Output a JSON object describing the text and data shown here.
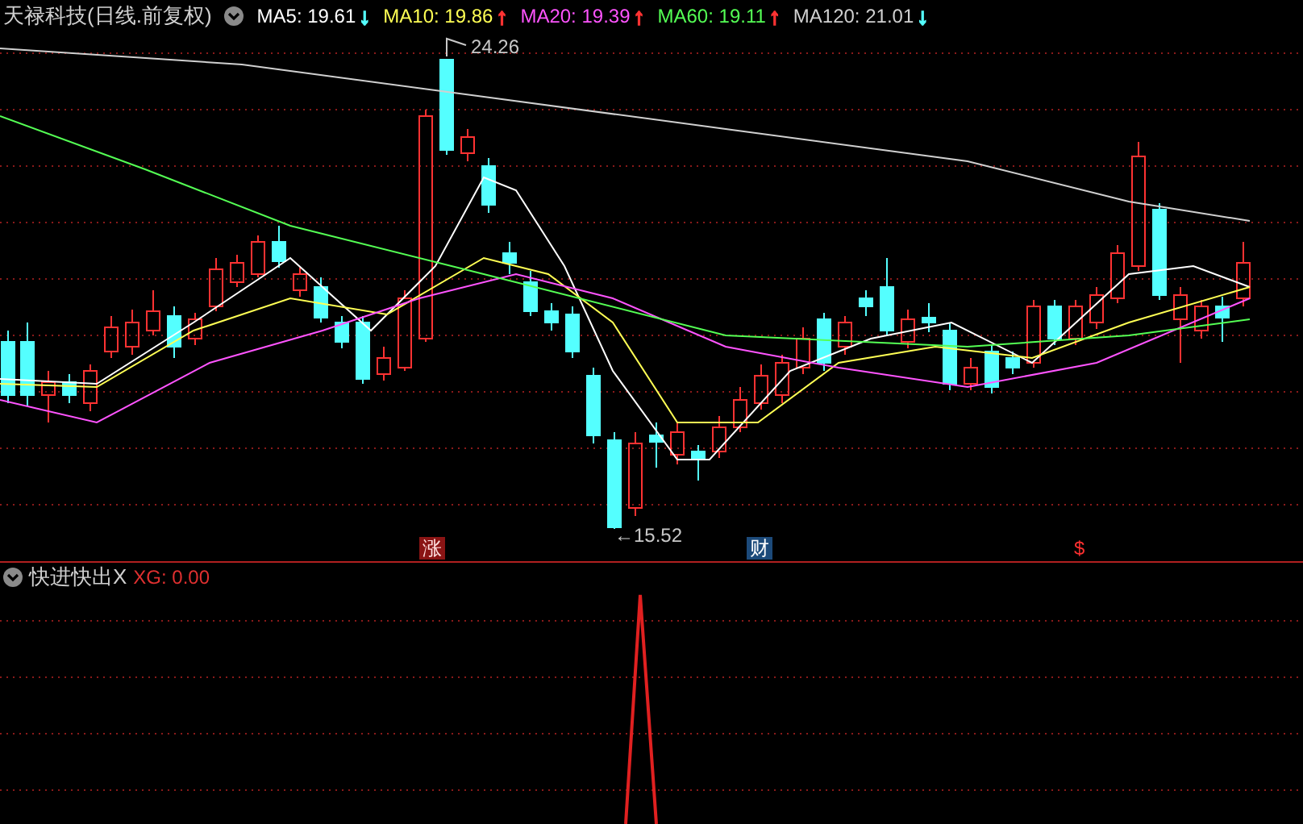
{
  "header": {
    "title": "天禄科技(日线.前复权)",
    "indicators": [
      {
        "text": "MA5: 19.61",
        "color": "#ffffff",
        "arrow": {
          "text": "↓",
          "color": "#54ffff"
        }
      },
      {
        "text": "MA10: 19.86",
        "color": "#ffff54",
        "arrow": {
          "text": "↑",
          "color": "#ff3232"
        }
      },
      {
        "text": "MA20: 19.39",
        "color": "#ff54ff",
        "arrow": {
          "text": "↑",
          "color": "#ff3232"
        }
      },
      {
        "text": "MA60: 19.11",
        "color": "#54ff54",
        "arrow": {
          "text": "↑",
          "color": "#ff3232"
        }
      },
      {
        "text": "MA120: 21.01",
        "color": "#d0d0d0",
        "arrow": {
          "text": "↓",
          "color": "#54ffff"
        }
      }
    ]
  },
  "chart": {
    "high_label": "24.26",
    "low_label": "15.52",
    "low_arrow": "←",
    "events": [
      {
        "text": "涨",
        "kind": "rise"
      },
      {
        "text": "财",
        "kind": "finance"
      },
      {
        "text": "$",
        "kind": "dividend"
      }
    ]
  },
  "sub_panel": {
    "title": "快进快出X",
    "reading": "XG: 0.00"
  }
}
